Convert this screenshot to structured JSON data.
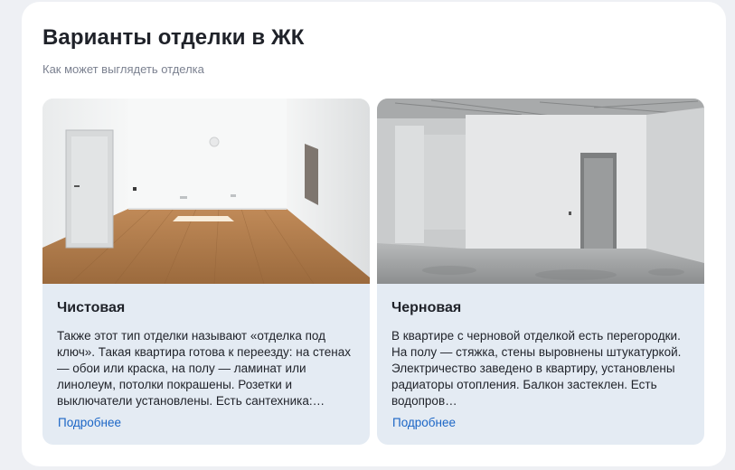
{
  "section": {
    "title": "Варианты отделки в ЖК",
    "subtitle": "Как может выглядеть отделка"
  },
  "cards": [
    {
      "title": "Чистовая",
      "description": "Также этот тип отделки называют «отделка под ключ». Такая квартира готова к переезду: на стенах — обои или краска, на полу — ламинат или линолеум, потолки покрашены. Розетки и выключатели установлены. Есть сантехника:…",
      "link_label": "Подробнее",
      "image": "finished-room-photo"
    },
    {
      "title": "Черновая",
      "description": "В квартире с черновой отделкой есть перегородки. На полу — стяжка, стены выровнены штукатуркой. Электричество заведено в квартиру, установлены радиаторы отопления. Балкон застеклен. Есть водопров…",
      "link_label": "Подробнее",
      "image": "rough-room-photo"
    }
  ]
}
